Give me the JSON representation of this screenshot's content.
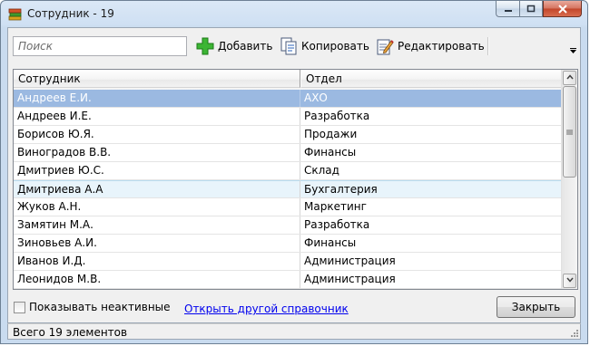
{
  "window": {
    "title": "Сотрудник - 19"
  },
  "toolbar": {
    "search_placeholder": "Поиск",
    "add_label": "Добавить",
    "copy_label": "Копировать",
    "edit_label": "Редактировать"
  },
  "table": {
    "headers": [
      "Сотрудник",
      "Отдел"
    ],
    "rows": [
      [
        "Андреев Е.И.",
        "АХО"
      ],
      [
        "Андреев И.Е.",
        "Разработка"
      ],
      [
        "Борисов Ю.Я.",
        "Продажи"
      ],
      [
        "Виноградов В.В.",
        "Финансы"
      ],
      [
        "Дмитриев Ю.С.",
        "Склад"
      ],
      [
        "Дмитриева А.А",
        "Бухгалтерия"
      ],
      [
        "Жуков А.Н.",
        "Маркетинг"
      ],
      [
        "Замятин М.А.",
        "Разработка"
      ],
      [
        "Зиновьев А.И.",
        "Финансы"
      ],
      [
        "Иванов И.Д.",
        "Администрация"
      ],
      [
        "Леонидов М.В.",
        "Администрация"
      ]
    ],
    "selected_row": 0,
    "hover_row": 5
  },
  "bottom": {
    "show_inactive_label": "Показывать неактивные",
    "open_other_link": "Открыть другой справочник",
    "close_label": "Закрыть"
  },
  "status": {
    "text": "Всего 19 элементов"
  },
  "colors": {
    "selection": "#9bb9e1",
    "hover": "#e8f4fb",
    "link": "#0000ee"
  }
}
